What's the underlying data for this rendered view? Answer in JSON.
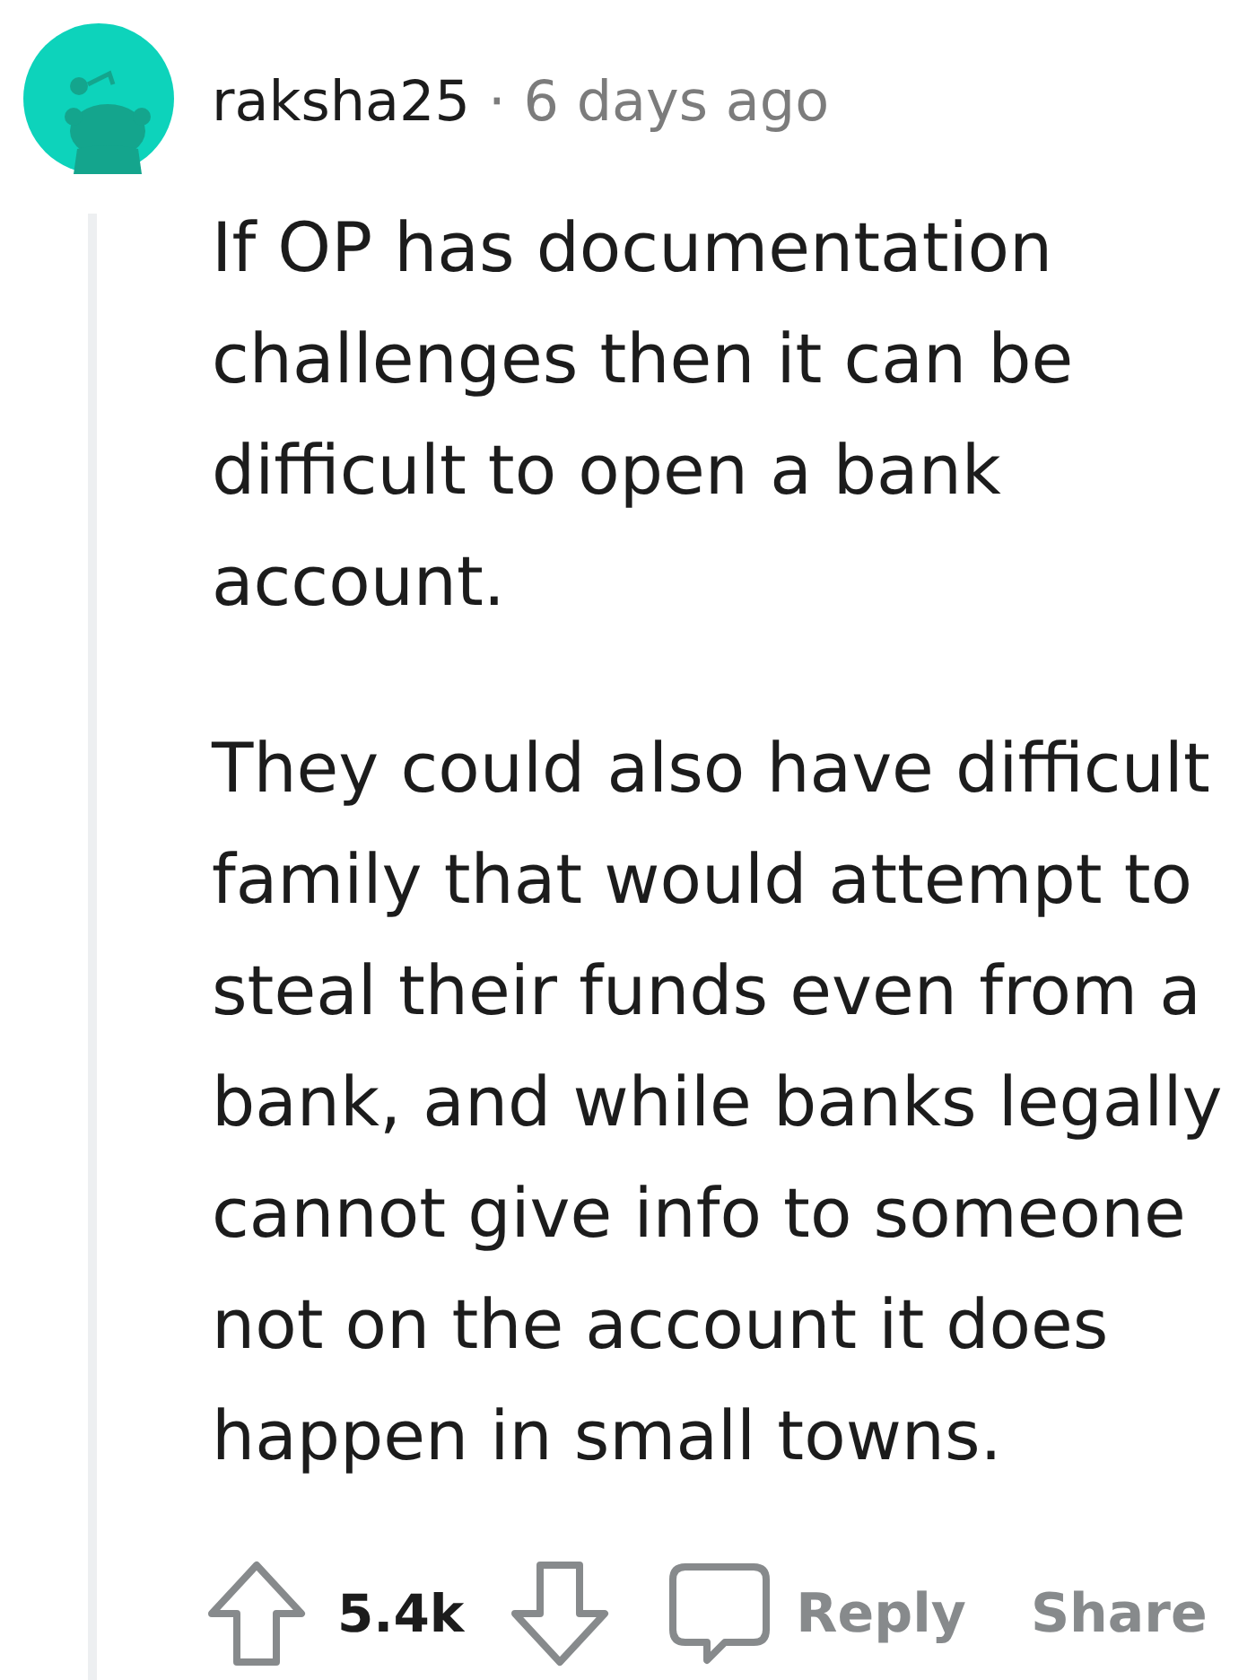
{
  "comment": {
    "author": "raksha25",
    "separator": "·",
    "time": "6 days ago",
    "paragraphs": [
      "If OP has documentation challenges then it can be difficult to open a bank account.",
      "They could also have difficult family that would attempt to steal their funds even from a bank, and while banks legally cannot give info to someone not on the account it does happen in small towns."
    ],
    "score": "5.4k",
    "actions": [
      {
        "kind": "reply",
        "label": "Reply"
      },
      {
        "kind": "share",
        "label": "Share"
      }
    ]
  }
}
